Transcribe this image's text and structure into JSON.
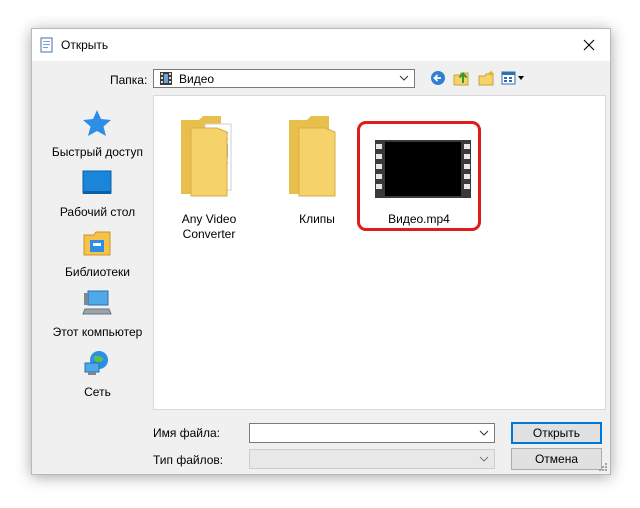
{
  "window": {
    "title": "Открыть"
  },
  "toolbar": {
    "folder_label": "Папка:",
    "folder_value": "Видео",
    "icons": [
      "back-arrow-icon",
      "up-folder-icon",
      "new-folder-icon",
      "view-menu-icon"
    ]
  },
  "places": [
    {
      "label": "Быстрый доступ",
      "icon": "star-icon"
    },
    {
      "label": "Рабочий стол",
      "icon": "desktop-icon"
    },
    {
      "label": "Библиотеки",
      "icon": "libraries-icon"
    },
    {
      "label": "Этот компьютер",
      "icon": "computer-icon"
    },
    {
      "label": "Сеть",
      "icon": "network-icon"
    }
  ],
  "files": [
    {
      "label": "Any Video Converter",
      "icon": "folder-with-documents-icon"
    },
    {
      "label": "Клипы",
      "icon": "folder-icon"
    },
    {
      "label": "Видео.mp4",
      "icon": "video-file-icon",
      "highlighted": true
    }
  ],
  "bottom": {
    "filename_label": "Имя файла:",
    "filename_value": "",
    "filetype_label": "Тип файлов:",
    "filetype_value": "",
    "open_button": "Открыть",
    "cancel_button": "Отмена"
  },
  "colors": {
    "highlight": "#e01b1b",
    "accent": "#0078d7",
    "folder": "#f6d26b"
  }
}
